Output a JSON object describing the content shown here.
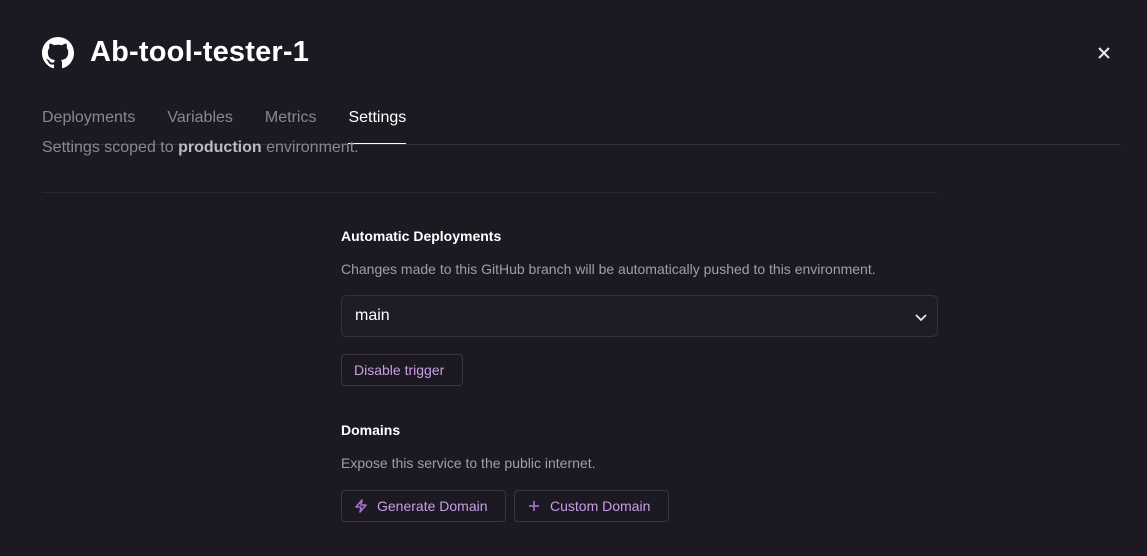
{
  "header": {
    "title": "Ab-tool-tester-1",
    "icon": "github-icon"
  },
  "tabs": [
    {
      "label": "Deployments",
      "active": false
    },
    {
      "label": "Variables",
      "active": false
    },
    {
      "label": "Metrics",
      "active": false
    },
    {
      "label": "Settings",
      "active": true
    }
  ],
  "scope": {
    "prefix": "Settings scoped to",
    "env": "production",
    "suffix": "environment."
  },
  "auto_deploy": {
    "title": "Automatic Deployments",
    "description": "Changes made to this GitHub branch will be automatically pushed to this environment.",
    "branch": "main",
    "disable_label": "Disable trigger"
  },
  "domains": {
    "title": "Domains",
    "description": "Expose this service to the public internet.",
    "generate_label": "Generate Domain",
    "custom_label": "Custom Domain"
  },
  "colors": {
    "background": "#1c1923",
    "accent": "#c79ee6"
  }
}
